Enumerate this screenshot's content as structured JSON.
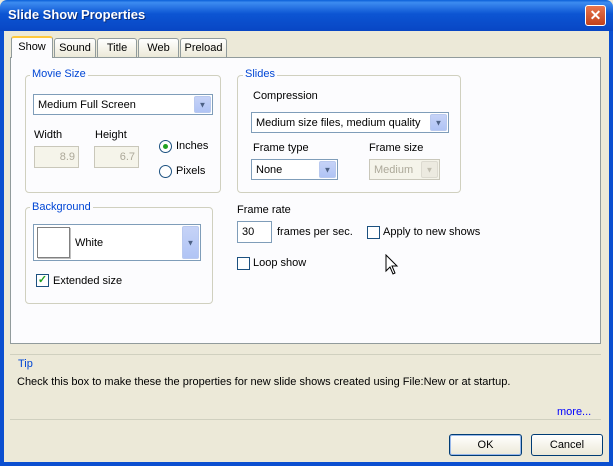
{
  "window": {
    "title": "Slide Show Properties",
    "close_glyph": "✕"
  },
  "tabs": [
    {
      "label": "Show",
      "active": true
    },
    {
      "label": "Sound",
      "active": false
    },
    {
      "label": "Title",
      "active": false
    },
    {
      "label": "Web",
      "active": false
    },
    {
      "label": "Preload",
      "active": false
    }
  ],
  "movie_size": {
    "legend": "Movie Size",
    "size_value": "Medium Full Screen",
    "width_label": "Width",
    "height_label": "Height",
    "width_value": "8.9",
    "height_value": "6.7",
    "units": [
      {
        "label": "Inches",
        "selected": true
      },
      {
        "label": "Pixels",
        "selected": false
      }
    ]
  },
  "slides": {
    "legend": "Slides",
    "compression_label": "Compression",
    "compression_value": "Medium size files, medium quality",
    "frame_type_label": "Frame type",
    "frame_type_value": "None",
    "frame_size_label": "Frame size",
    "frame_size_value": "Medium"
  },
  "background": {
    "legend": "Background",
    "color_value": "White",
    "swatch_color": "#ffffff",
    "extended_size_label": "Extended size",
    "extended_size_checked": true
  },
  "frame_rate": {
    "label": "Frame rate",
    "value": "30",
    "unit_label": "frames per sec.",
    "apply_label": "Apply to new shows",
    "apply_checked": false
  },
  "loop_show": {
    "label": "Loop show",
    "checked": false
  },
  "tip": {
    "legend": "Tip",
    "text": "Check this box to make these the properties for new slide shows created using File:New or at startup.",
    "more_link": "more..."
  },
  "buttons": {
    "ok": "OK",
    "cancel": "Cancel"
  },
  "colors": {
    "titlebar": "#0846c4",
    "legend_text": "#0046d5",
    "tab_highlight": "#ffc83c",
    "check_green": "#21a121"
  },
  "icons": {
    "dropdown": "▼",
    "check": "✓"
  }
}
